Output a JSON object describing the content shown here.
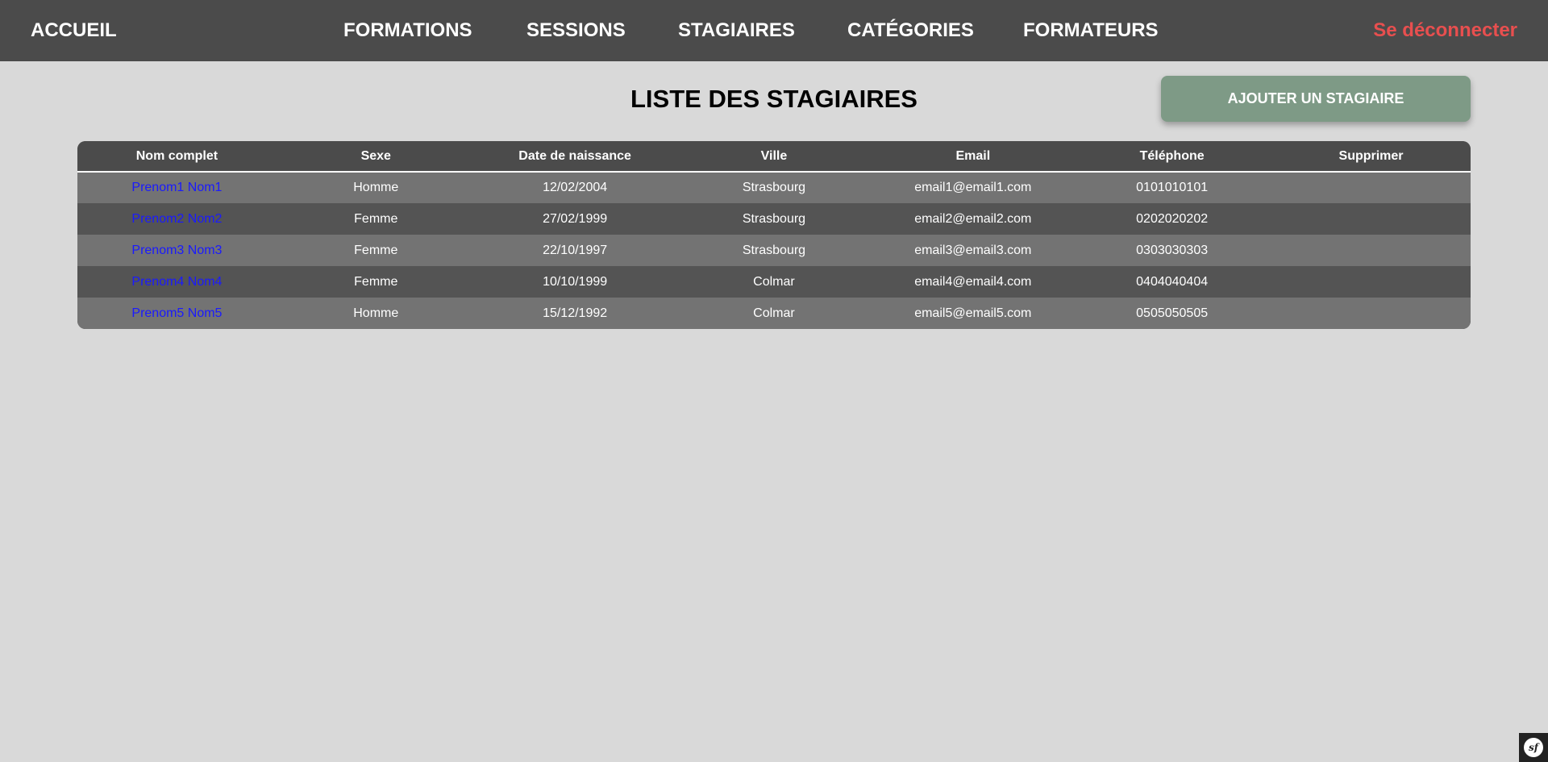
{
  "nav": {
    "home": "ACCUEIL",
    "formations": "FORMATIONS",
    "sessions": "SESSIONS",
    "stagiaires": "STAGIAIRES",
    "categories": "CATÉGORIES",
    "formateurs": "FORMATEURS",
    "logout": "Se déconnecter"
  },
  "page": {
    "title": "LISTE DES STAGIAIRES",
    "add_button": "AJOUTER UN STAGIAIRE"
  },
  "table": {
    "headers": [
      "Nom complet",
      "Sexe",
      "Date de naissance",
      "Ville",
      "Email",
      "Téléphone",
      "Supprimer"
    ],
    "rows": [
      {
        "name": "Prenom1 Nom1",
        "sexe": "Homme",
        "birth": "12/02/2004",
        "ville": "Strasbourg",
        "email": "email1@email1.com",
        "phone": "0101010101"
      },
      {
        "name": "Prenom2 Nom2",
        "sexe": "Femme",
        "birth": "27/02/1999",
        "ville": "Strasbourg",
        "email": "email2@email2.com",
        "phone": "0202020202"
      },
      {
        "name": "Prenom3 Nom3",
        "sexe": "Femme",
        "birth": "22/10/1997",
        "ville": "Strasbourg",
        "email": "email3@email3.com",
        "phone": "0303030303"
      },
      {
        "name": "Prenom4 Nom4",
        "sexe": "Femme",
        "birth": "10/10/1999",
        "ville": "Colmar",
        "email": "email4@email4.com",
        "phone": "0404040404"
      },
      {
        "name": "Prenom5 Nom5",
        "sexe": "Homme",
        "birth": "15/12/1992",
        "ville": "Colmar",
        "email": "email5@email5.com",
        "phone": "0505050505"
      }
    ]
  },
  "toolbar": {
    "icon": "symfony-icon",
    "label": "sf"
  },
  "colors": {
    "navbar": "#4b4b4b",
    "background": "#d9d9d9",
    "logout": "#e84f4f",
    "add_button": "#7e9a86",
    "link": "#1a1aff",
    "row_light": "#737373",
    "row_dark": "#545454"
  }
}
